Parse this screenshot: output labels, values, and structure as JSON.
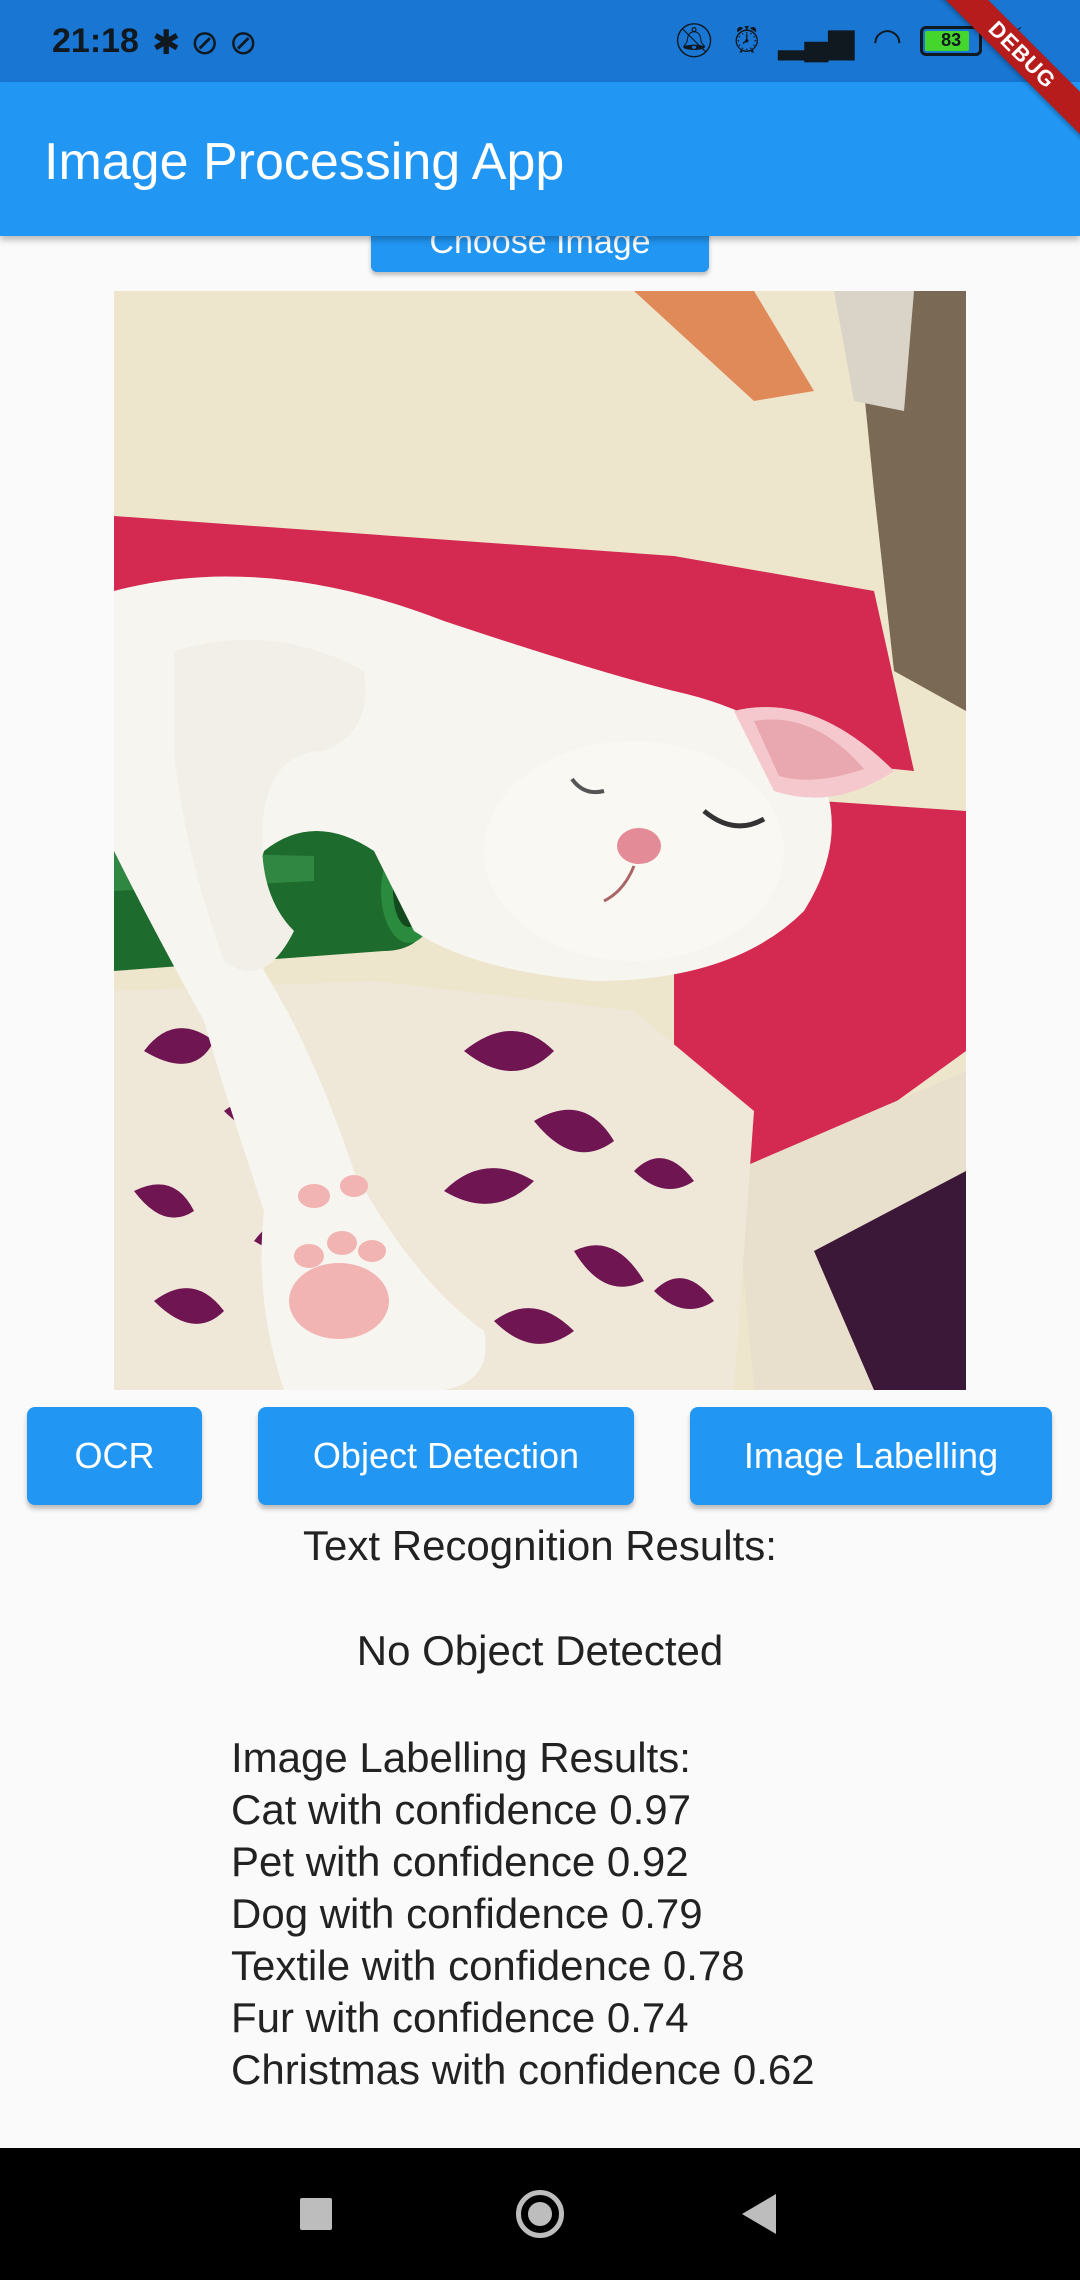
{
  "status_bar": {
    "time": "21:18",
    "battery_percent": "83",
    "icons_left": [
      "bluetooth-icon",
      "sync-icon",
      "sync-icon"
    ],
    "icons_right": [
      "mute-icon",
      "alarm-icon",
      "signal-icon",
      "wifi-icon",
      "battery-icon",
      "charging-icon"
    ]
  },
  "debug_banner": "DEBUG",
  "app_bar": {
    "title": "Image Processing App"
  },
  "choose_button": {
    "label": "Choose Image"
  },
  "actions": {
    "ocr_label": "OCR",
    "object_detection_label": "Object Detection",
    "image_labelling_label": "Image Labelling"
  },
  "results": {
    "ocr_heading": "Text Recognition Results:",
    "object_result": "No Object Detected",
    "labelling_heading": "Image Labelling Results:",
    "labels": [
      "Cat with confidence 0.97",
      "Pet with confidence 0.92",
      "Dog with confidence 0.79",
      "Textile with confidence 0.78",
      "Fur with confidence 0.74",
      "Christmas with confidence 0.62"
    ]
  },
  "colors": {
    "primary": "#2196F3",
    "status_bar": "#1976D2",
    "debug_ribbon": "#B71C1C",
    "background": "#FAFAFA"
  }
}
